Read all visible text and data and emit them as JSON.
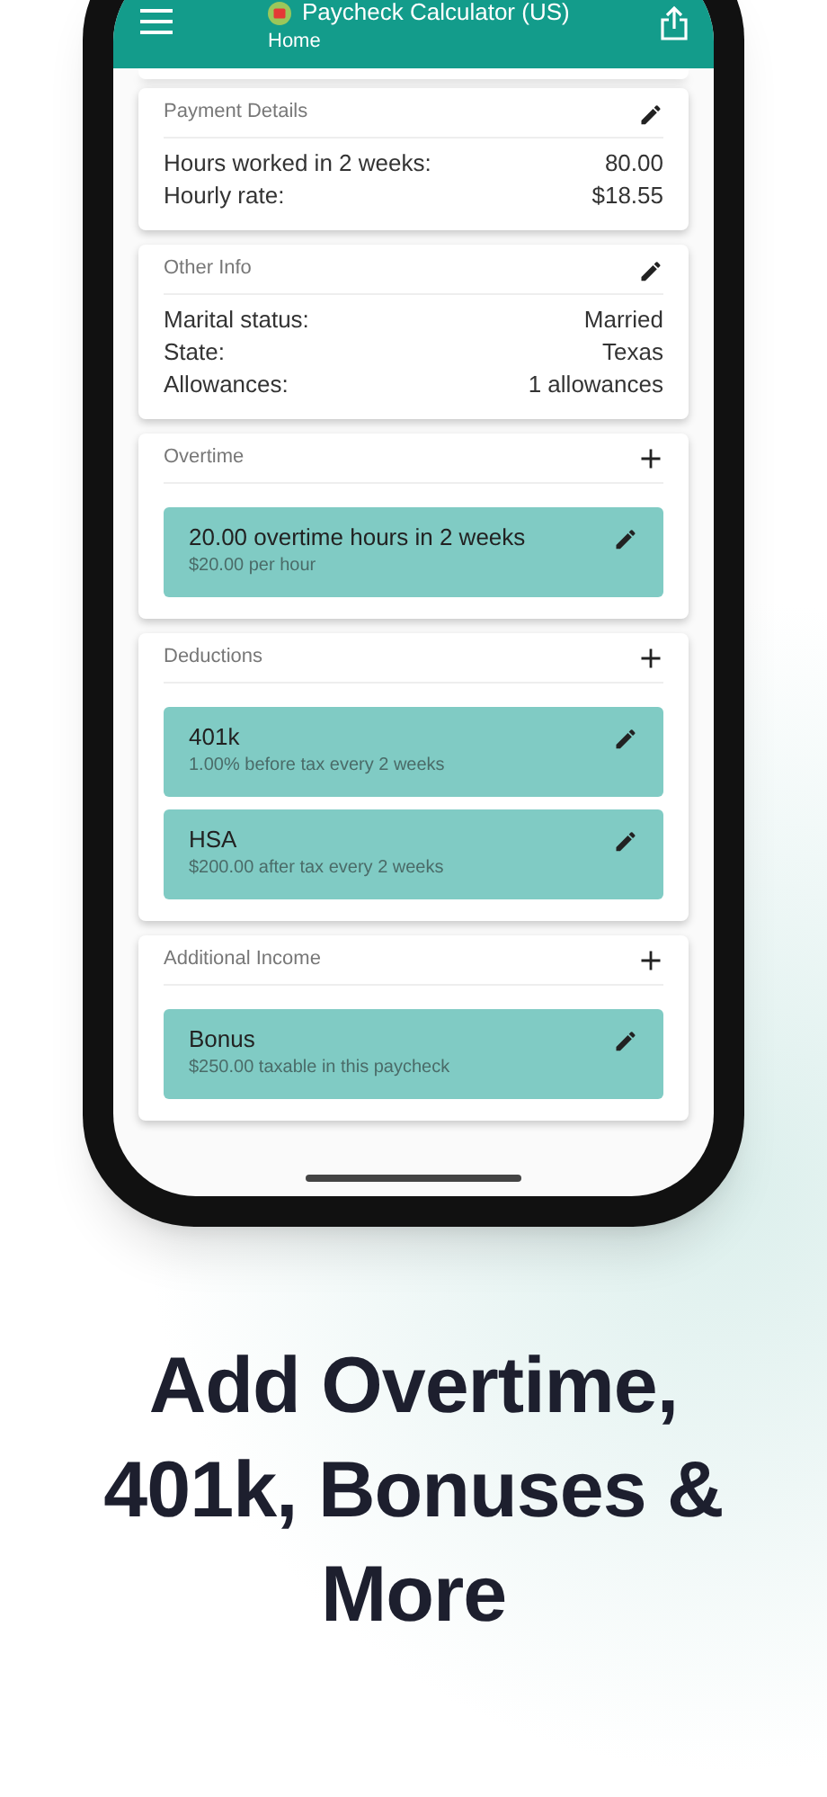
{
  "app_bar": {
    "title": "Paycheck Calculator (US)",
    "subtitle": "Home"
  },
  "cards": [
    {
      "title": "Payment Details",
      "kind": "edit",
      "rows": [
        {
          "label": "Hours worked in 2 weeks:",
          "value": "80.00"
        },
        {
          "label": "Hourly rate:",
          "value": "$18.55"
        }
      ]
    },
    {
      "title": "Other Info",
      "kind": "edit",
      "rows": [
        {
          "label": "Marital status:",
          "value": "Married"
        },
        {
          "label": "State:",
          "value": "Texas"
        },
        {
          "label": "Allowances:",
          "value": "1 allowances"
        }
      ]
    },
    {
      "title": "Overtime",
      "kind": "add",
      "items": [
        {
          "title": "20.00 overtime hours in 2 weeks",
          "detail": "$20.00 per hour"
        }
      ]
    },
    {
      "title": "Deductions",
      "kind": "add",
      "items": [
        {
          "title": "401k",
          "detail": "1.00% before tax every 2 weeks"
        },
        {
          "title": "HSA",
          "detail": "$200.00 after tax every 2 weeks"
        }
      ]
    },
    {
      "title": "Additional Income",
      "kind": "add",
      "items": [
        {
          "title": "Bonus",
          "detail": "$250.00 taxable in this paycheck"
        }
      ]
    }
  ],
  "headline": "Add Overtime, 401k, Bonuses & More"
}
